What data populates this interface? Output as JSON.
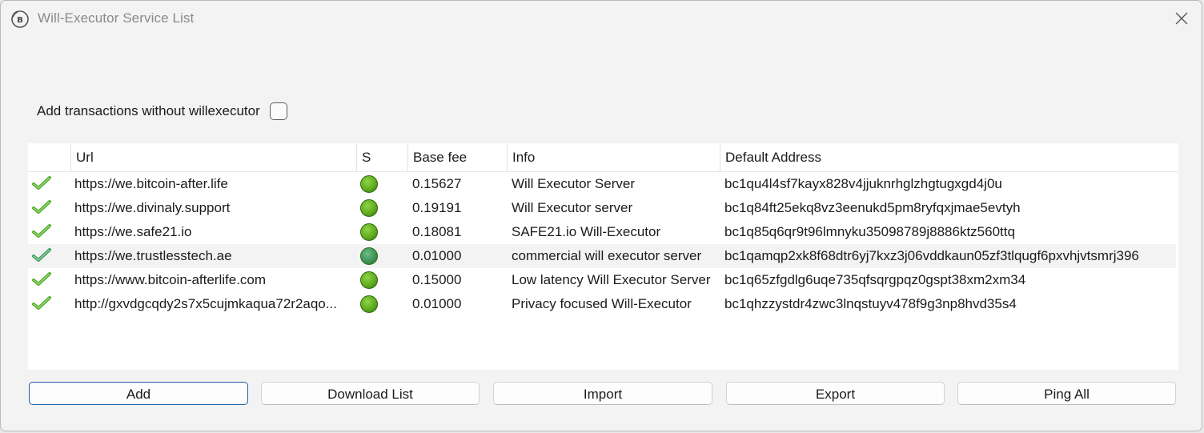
{
  "window": {
    "title": "Will-Executor Service List",
    "app_icon": "bitcoin-clock-icon",
    "close_icon": "close-icon"
  },
  "options": {
    "add_without_executor_label": "Add transactions without willexecutor",
    "add_without_executor_checked": false
  },
  "table": {
    "headers": {
      "check": "",
      "url": "Url",
      "status": "S",
      "base_fee": "Base fee",
      "info": "Info",
      "address": "Default Address"
    },
    "rows": [
      {
        "url": "https://we.bitcoin-after.life",
        "status": "online",
        "base_fee": "0.15627",
        "info": "Will Executor Server",
        "address": "bc1qu4l4sf7kayx828v4jjuknrhglzhgtugxgd4j0u"
      },
      {
        "url": "https://we.divinaly.support",
        "status": "online",
        "base_fee": "0.19191",
        "info": "Will Executor server",
        "address": "bc1q84ft25ekq8vz3eenukd5pm8ryfqxjmae5evtyh"
      },
      {
        "url": "https://we.safe21.io",
        "status": "online",
        "base_fee": "0.18081",
        "info": "SAFE21.io Will-Executor",
        "address": "bc1q85q6qr9t96lmnyku35098789j8886ktz560ttq"
      },
      {
        "url": "https://we.trustlesstech.ae",
        "status": "online",
        "base_fee": "0.01000",
        "info": "commercial will executor server",
        "address": "bc1qamqp2xk8f68dtr6yj7kxz3j06vddkaun05zf3tlqugf6pxvhjvtsmrj396"
      },
      {
        "url": "https://www.bitcoin-afterlife.com",
        "status": "online",
        "base_fee": "0.15000",
        "info": "Low latency Will Executor Server",
        "address": "bc1q65zfgdlg6uqe735qfsqrgpqz0gspt38xm2xm34"
      },
      {
        "url": "http://gxvdgcqdy2s7x5cujmkaqua72r2aqo...",
        "status": "online",
        "base_fee": "0.01000",
        "info": "Privacy focused Will-Executor",
        "address": "bc1qhzzystdr4zwc3lnqstuyv478f9g3np8hvd35s4"
      }
    ],
    "highlighted_row": 3
  },
  "buttons": {
    "add": "Add",
    "download": "Download List",
    "import": "Import",
    "export": "Export",
    "ping_all": "Ping All"
  },
  "colors": {
    "status_online": "#5aa81a",
    "check_green": "#4caf2a",
    "primary_border": "#1f5fa8"
  }
}
